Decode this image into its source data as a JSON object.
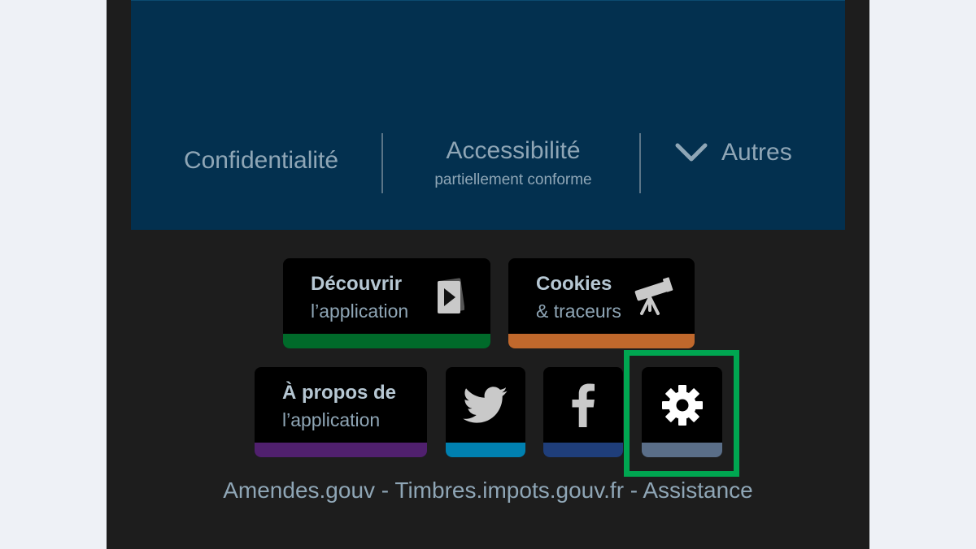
{
  "footer": {
    "privacy_label": "Confidentialité",
    "accessibility_label": "Accessibilité",
    "accessibility_sub": "partiellement conforme",
    "other_label": "Autres"
  },
  "tiles": {
    "discover": {
      "line1": "Découvrir",
      "line2": "l’application",
      "accent": "#006a2a",
      "icon": "play-icon"
    },
    "cookies": {
      "line1": "Cookies",
      "line2": "& traceurs",
      "accent": "#c0682c",
      "icon": "telescope-icon"
    },
    "about": {
      "line1": "À propos de",
      "line2": "l’application",
      "accent": "#50206e",
      "icon": ""
    },
    "twitter": {
      "accent": "#0080b0",
      "icon": "twitter-icon"
    },
    "facebook": {
      "accent": "#1f3e7a",
      "icon": "facebook-icon"
    },
    "settings": {
      "accent": "#5a6e88",
      "icon": "gear-icon",
      "highlight_color": "#00a651"
    }
  },
  "bottom_links": "Amendes.gouv - Timbres.impots.gouv.fr - Assistance",
  "colors": {
    "background": "#eef1f6",
    "phone_bg": "#1d1d1d",
    "panel_blue": "#03304f",
    "text_muted": "#8fa6b6"
  }
}
